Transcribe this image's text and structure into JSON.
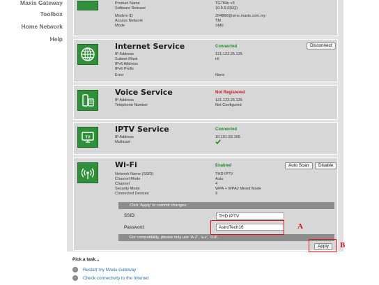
{
  "sidebar": {
    "items": [
      {
        "label": "Maxis Gateway"
      },
      {
        "label": "Toolbox"
      },
      {
        "label": "Home Network"
      },
      {
        "label": "Help"
      }
    ]
  },
  "gateway_panel": {
    "rows": [
      {
        "label": "Product Name",
        "value": "TG784n v3"
      },
      {
        "label": "Software Release",
        "value": "10.5.6.0(EQ)"
      },
      {
        "label": "Modem ID",
        "value": "204860@sme.maxis.com.my"
      },
      {
        "label": "Access Network",
        "value": "TM"
      },
      {
        "label": "Mode",
        "value": "SME"
      }
    ]
  },
  "internet": {
    "title": "Internet Service",
    "status": "Connected",
    "disconnect_label": "Disconnect",
    "rows": [
      {
        "label": "IP Address",
        "value": "121.122.25.125"
      },
      {
        "label": "Subnet Mask",
        "value": "nil"
      },
      {
        "label": "IPv6 Address",
        "value": ""
      },
      {
        "label": "IPv6 Prefix",
        "value": ""
      },
      {
        "label": "Error",
        "value": "None"
      }
    ]
  },
  "voice": {
    "title": "Voice Service",
    "status": "Not Registered",
    "rows": [
      {
        "label": "IP Address",
        "value": "121.122.25.125"
      },
      {
        "label": "Telephone Number",
        "value": "Not Configured"
      }
    ]
  },
  "iptv": {
    "title": "IPTV Service",
    "status": "Connected",
    "icon_text": "TV",
    "rows": [
      {
        "label": "IP Address",
        "value": "10.101.93.165"
      },
      {
        "label": "Multicast",
        "value": ""
      }
    ]
  },
  "wifi": {
    "title": "Wi-Fi",
    "status": "Enabled",
    "auto_scan_label": "Auto Scan",
    "disable_label": "Disable",
    "rows": [
      {
        "label": "Network Name (SSID)",
        "value": "THD IPTV"
      },
      {
        "label": "Channel Mode",
        "value": "Auto"
      },
      {
        "label": "Channel",
        "value": "4"
      },
      {
        "label": "Security Mode",
        "value": "WPA + WPA2 Mixed Mode"
      },
      {
        "label": "Connected Devices",
        "value": "9"
      }
    ],
    "commit_note": "Click 'Apply' to commit changes.",
    "ssid_label": "SSID:",
    "ssid_value": "THD IPTV",
    "password_label": "Password:",
    "password_value": "AstroTech16",
    "compat_note": "For compatibility, please only use 'A-Z', 'a-z', '0-9'.",
    "apply_label": "Apply"
  },
  "annotations": {
    "a": "A",
    "b": "B",
    "color": "#d8141c"
  },
  "tasks": {
    "title": "Pick a task...",
    "items": [
      {
        "label": "Restart my Maxis Gateway"
      },
      {
        "label": "Check connectivity to the Internet"
      }
    ]
  },
  "colors": {
    "connected": "#1f8a2c",
    "not_registered": "#c8161d",
    "icon_green": "#2f8f3b",
    "link": "#2a6fb0"
  }
}
